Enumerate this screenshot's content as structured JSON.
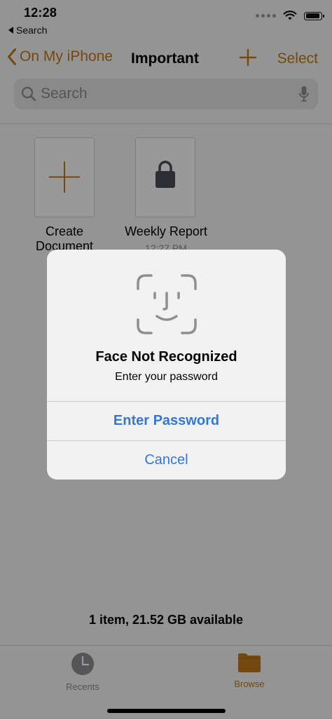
{
  "status_bar": {
    "time": "12:28",
    "back_app": "Search"
  },
  "nav": {
    "back_label": "On My iPhone",
    "title": "Important",
    "select_label": "Select"
  },
  "search": {
    "placeholder": "Search"
  },
  "files": [
    {
      "name_line1": "Create",
      "name_line2": "Document",
      "subtitle": ""
    },
    {
      "name_line1": "Weekly Report",
      "name_line2": "",
      "subtitle": "12:27 PM"
    }
  ],
  "footer": {
    "storage_text": "1 item, 21.52 GB available"
  },
  "tabs": [
    {
      "label": "Recents",
      "icon": "clock-icon"
    },
    {
      "label": "Browse",
      "icon": "folder-icon",
      "active": true
    }
  ],
  "alert": {
    "icon": "face-id-icon",
    "title": "Face Not Recognized",
    "message": "Enter your password",
    "primary_button": "Enter Password",
    "cancel_button": "Cancel"
  },
  "colors": {
    "accent": "#c07a1a",
    "link_blue": "#3478d4"
  }
}
